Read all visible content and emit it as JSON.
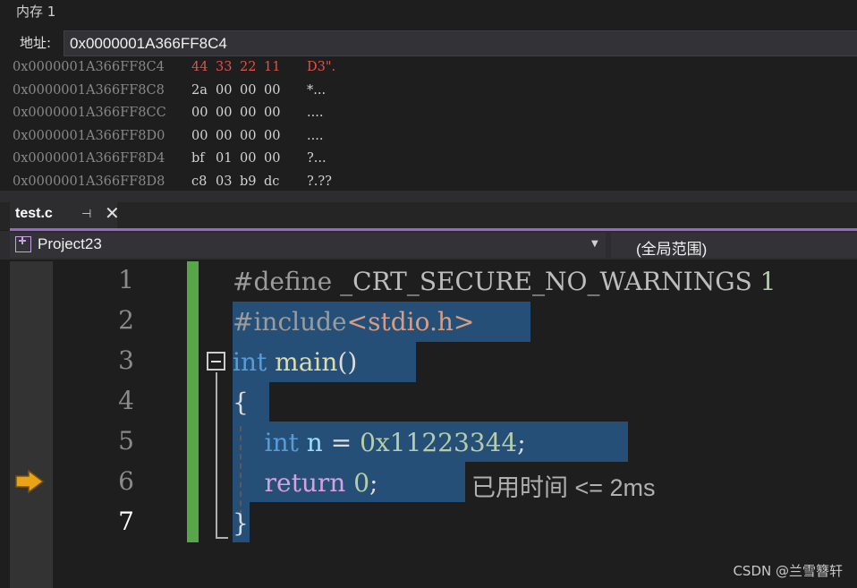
{
  "memory_window": {
    "title": "内存 1",
    "address_label": "地址:",
    "address_value": "0x0000001A366FF8C4",
    "rows": [
      {
        "addr": "0x0000001A366FF8C4",
        "bytes": [
          "44",
          "33",
          "22",
          "11"
        ],
        "ascii": "D3\".",
        "changed": true
      },
      {
        "addr": "0x0000001A366FF8C8",
        "bytes": [
          "2a",
          "00",
          "00",
          "00"
        ],
        "ascii": "*...",
        "changed": false
      },
      {
        "addr": "0x0000001A366FF8CC",
        "bytes": [
          "00",
          "00",
          "00",
          "00"
        ],
        "ascii": "....",
        "changed": false
      },
      {
        "addr": "0x0000001A366FF8D0",
        "bytes": [
          "00",
          "00",
          "00",
          "00"
        ],
        "ascii": "....",
        "changed": false
      },
      {
        "addr": "0x0000001A366FF8D4",
        "bytes": [
          "bf",
          "01",
          "00",
          "00"
        ],
        "ascii": "?...",
        "changed": false
      },
      {
        "addr": "0x0000001A366FF8D8",
        "bytes": [
          "c8",
          "03",
          "b9",
          "dc"
        ],
        "ascii": "?.??",
        "changed": false
      }
    ]
  },
  "tab": {
    "label": "test.c",
    "pin_icon": "pin-icon",
    "close_icon": "close-icon",
    "accent_color": "#9966cc"
  },
  "navbar": {
    "project": "Project23",
    "scope": "(全局范围)"
  },
  "editor": {
    "line_numbers": [
      "1",
      "2",
      "3",
      "4",
      "5",
      "6",
      "7"
    ],
    "current_line": "7",
    "execution_pointer_line": "6",
    "lines": [
      [
        {
          "t": "#define",
          "c": "kw-pre"
        },
        {
          "t": " ",
          "c": "plain"
        },
        {
          "t": "_CRT_SECURE_NO_WARNINGS",
          "c": "ident"
        },
        {
          "t": " ",
          "c": "plain"
        },
        {
          "t": "1",
          "c": "num"
        }
      ],
      [
        {
          "t": "#include",
          "c": "kw-pre"
        },
        {
          "t": "<stdio.h>",
          "c": "str"
        }
      ],
      [
        {
          "t": "int",
          "c": "kw"
        },
        {
          "t": " ",
          "c": "plain"
        },
        {
          "t": "main",
          "c": "fn"
        },
        {
          "t": "()",
          "c": "plain"
        }
      ],
      [
        {
          "t": "{",
          "c": "plain"
        }
      ],
      [
        {
          "t": "    ",
          "c": "plain"
        },
        {
          "t": "int",
          "c": "kw"
        },
        {
          "t": " ",
          "c": "plain"
        },
        {
          "t": "n",
          "c": "var"
        },
        {
          "t": " = ",
          "c": "plain"
        },
        {
          "t": "0x11223344",
          "c": "num"
        },
        {
          "t": ";",
          "c": "plain"
        }
      ],
      [
        {
          "t": "    ",
          "c": "plain"
        },
        {
          "t": "return",
          "c": "ctl"
        },
        {
          "t": " ",
          "c": "plain"
        },
        {
          "t": "0",
          "c": "num"
        },
        {
          "t": ";",
          "c": "plain"
        }
      ],
      [
        {
          "t": "}",
          "c": "plain"
        }
      ]
    ],
    "perf_tip": "已用时间 <= 2ms",
    "change_bar_color": "#57a64a",
    "selection_color": "#264f78",
    "arrow_color": "#e8a317"
  },
  "watermark": "CSDN @兰雪簪轩"
}
